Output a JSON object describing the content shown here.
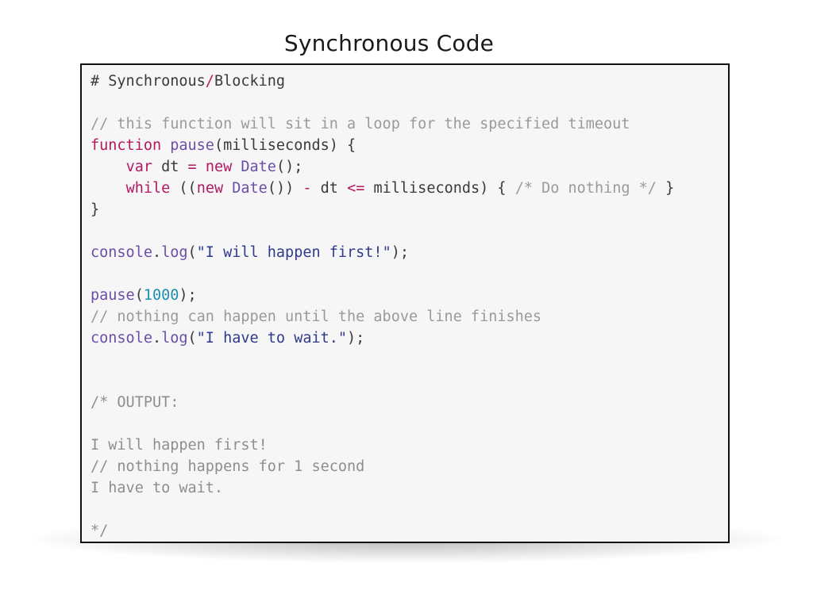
{
  "title": "Synchronous Code",
  "code_lines": [
    [
      {
        "t": "# Synchronous",
        "k": "plain"
      },
      {
        "t": "/",
        "k": "operator"
      },
      {
        "t": "Blocking",
        "k": "plain"
      }
    ],
    [],
    [
      {
        "t": "// this function will sit in a loop for the specified timeout",
        "k": "comment"
      }
    ],
    [
      {
        "t": "function",
        "k": "keyword"
      },
      {
        "t": " ",
        "k": "plain"
      },
      {
        "t": "pause",
        "k": "fn"
      },
      {
        "t": "(milliseconds) {",
        "k": "plain"
      }
    ],
    [
      {
        "t": "    ",
        "k": "plain"
      },
      {
        "t": "var",
        "k": "keyword"
      },
      {
        "t": " dt ",
        "k": "plain"
      },
      {
        "t": "=",
        "k": "operator"
      },
      {
        "t": " ",
        "k": "plain"
      },
      {
        "t": "new",
        "k": "keyword"
      },
      {
        "t": " ",
        "k": "plain"
      },
      {
        "t": "Date",
        "k": "fn"
      },
      {
        "t": "();",
        "k": "plain"
      }
    ],
    [
      {
        "t": "    ",
        "k": "plain"
      },
      {
        "t": "while",
        "k": "keyword"
      },
      {
        "t": " ((",
        "k": "plain"
      },
      {
        "t": "new",
        "k": "keyword"
      },
      {
        "t": " ",
        "k": "plain"
      },
      {
        "t": "Date",
        "k": "fn"
      },
      {
        "t": "()) ",
        "k": "plain"
      },
      {
        "t": "-",
        "k": "operator"
      },
      {
        "t": " dt ",
        "k": "plain"
      },
      {
        "t": "<=",
        "k": "operator"
      },
      {
        "t": " milliseconds) { ",
        "k": "plain"
      },
      {
        "t": "/* Do nothing */",
        "k": "comment"
      },
      {
        "t": " }",
        "k": "plain"
      }
    ],
    [
      {
        "t": "}",
        "k": "plain"
      }
    ],
    [],
    [
      {
        "t": "console",
        "k": "fn"
      },
      {
        "t": ".",
        "k": "plain"
      },
      {
        "t": "log",
        "k": "fn"
      },
      {
        "t": "(",
        "k": "plain"
      },
      {
        "t": "\"I will happen first!\"",
        "k": "string"
      },
      {
        "t": ");",
        "k": "plain"
      }
    ],
    [],
    [
      {
        "t": "pause",
        "k": "fn"
      },
      {
        "t": "(",
        "k": "plain"
      },
      {
        "t": "1000",
        "k": "number"
      },
      {
        "t": ");",
        "k": "plain"
      }
    ],
    [
      {
        "t": "// nothing can happen until the above line finishes",
        "k": "comment"
      }
    ],
    [
      {
        "t": "console",
        "k": "fn"
      },
      {
        "t": ".",
        "k": "plain"
      },
      {
        "t": "log",
        "k": "fn"
      },
      {
        "t": "(",
        "k": "plain"
      },
      {
        "t": "\"I have to wait.\"",
        "k": "string"
      },
      {
        "t": ");",
        "k": "plain"
      }
    ],
    [],
    [],
    [
      {
        "t": "/* OUTPUT:",
        "k": "output"
      }
    ],
    [],
    [
      {
        "t": "I will happen first!",
        "k": "output"
      }
    ],
    [
      {
        "t": "// nothing happens for 1 second",
        "k": "output"
      }
    ],
    [
      {
        "t": "I have to wait.",
        "k": "output"
      }
    ],
    [],
    [
      {
        "t": "*/",
        "k": "output"
      }
    ]
  ]
}
